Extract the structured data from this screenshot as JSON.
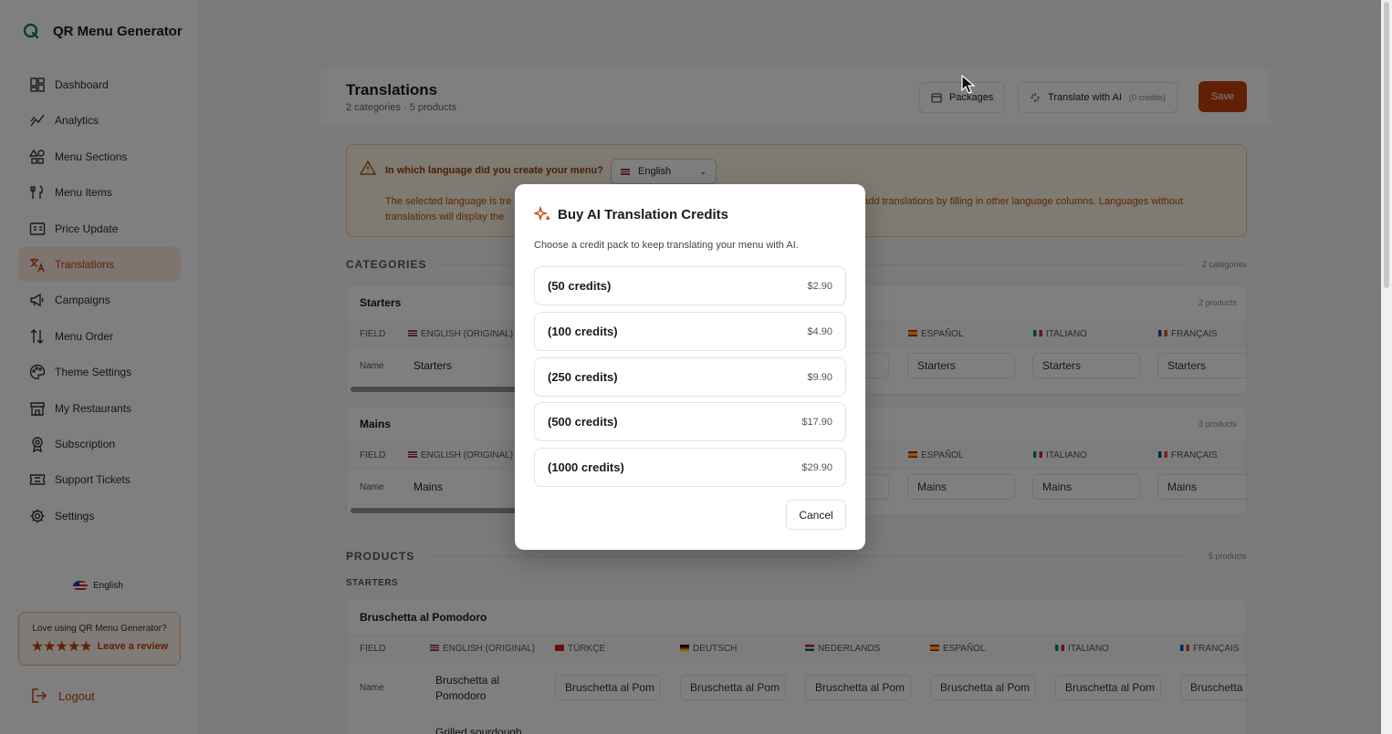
{
  "brand": {
    "name": "QR Menu Generator"
  },
  "sidebar": {
    "items": [
      {
        "label": "Dashboard",
        "icon": "dashboard-icon"
      },
      {
        "label": "Analytics",
        "icon": "analytics-icon"
      },
      {
        "label": "Menu Sections",
        "icon": "shapes-icon"
      },
      {
        "label": "Menu Items",
        "icon": "utensils-icon"
      },
      {
        "label": "Price Update",
        "icon": "price-tag-icon"
      },
      {
        "label": "Translations",
        "icon": "translate-icon",
        "active": true
      },
      {
        "label": "Campaigns",
        "icon": "megaphone-icon"
      },
      {
        "label": "Menu Order",
        "icon": "sort-icon"
      },
      {
        "label": "Theme Settings",
        "icon": "palette-icon"
      },
      {
        "label": "My Restaurants",
        "icon": "store-icon"
      },
      {
        "label": "Subscription",
        "icon": "badge-icon"
      },
      {
        "label": "Support Tickets",
        "icon": "ticket-icon"
      },
      {
        "label": "Settings",
        "icon": "gear-icon"
      }
    ],
    "language": "English",
    "review": {
      "title": "Love using QR Menu Generator?",
      "stars": "★★★★★",
      "link": "Leave a review"
    },
    "logout": "Logout"
  },
  "header": {
    "title": "Translations",
    "subtitle": "2 categories · 5 products",
    "packages_label": "Packages",
    "translate_label": "Translate with AI",
    "translate_credits": "(0 credits)",
    "save_label": "Save"
  },
  "alert": {
    "question": "In which language did you create your menu?",
    "selected_language": "English",
    "text_line1_start": "The selected language is tre",
    "text_line1_end": "add translations by filling in other language columns. Languages without",
    "text_line2": "translations will display the"
  },
  "categories": {
    "label": "CATEGORIES",
    "count": "2 categories",
    "cards": [
      {
        "title": "Starters",
        "count": "2 products",
        "headers": {
          "field": "FIELD",
          "original": "ENGLISH (ORIGINAL)",
          "es": "ESPAÑOL",
          "it": "ITALIANO",
          "fr": "FRANÇAIS"
        },
        "row_label": "Name",
        "original": "Starters",
        "values": {
          "es": "Starters",
          "it": "Starters",
          "fr": "Starters"
        }
      },
      {
        "title": "Mains",
        "count": "3 products",
        "headers": {
          "field": "FIELD",
          "original": "ENGLISH (ORIGINAL)",
          "es": "ESPAÑOL",
          "it": "ITALIANO",
          "fr": "FRANÇAIS"
        },
        "row_label": "Name",
        "original": "Mains",
        "values": {
          "es": "Mains",
          "it": "Mains",
          "fr": "Mains"
        }
      }
    ]
  },
  "products": {
    "label": "PRODUCTS",
    "count": "5 products",
    "group": "STARTERS",
    "card": {
      "title": "Bruschetta al Pomodoro",
      "headers": {
        "field": "FIELD",
        "original": "ENGLISH (ORIGINAL)",
        "tr": "TÜRKÇE",
        "de": "DEUTSCH",
        "nl": "NEDERLANDS",
        "es": "ESPAÑOL",
        "it": "ITALIANO",
        "fr": "FRANÇAIS"
      },
      "row_label": "Name",
      "original_line1": "Bruschetta al",
      "original_line2": "Pomodoro",
      "values": {
        "tr": "Bruschetta al Pom",
        "de": "Bruschetta al Pom",
        "nl": "Bruschetta al Pom",
        "es": "Bruschetta al Pom",
        "it": "Bruschetta al Pom",
        "fr": "Bruschetta al Pomodoro"
      },
      "next_row_original": "Grilled sourdough"
    }
  },
  "modal": {
    "title": "Buy AI Translation Credits",
    "description": "Choose a credit pack to keep translating your menu with AI.",
    "packs": [
      {
        "name": "(50 credits)",
        "price": "$2.90"
      },
      {
        "name": "(100 credits)",
        "price": "$4.90"
      },
      {
        "name": "(250 credits)",
        "price": "$9.90"
      },
      {
        "name": "(500 credits)",
        "price": "$17.90"
      },
      {
        "name": "(1000 credits)",
        "price": "$29.90"
      }
    ],
    "cancel_label": "Cancel"
  },
  "colors": {
    "accent": "#c2410c",
    "active_bg": "#fde8e1",
    "alert_bg": "#fff4e5"
  }
}
